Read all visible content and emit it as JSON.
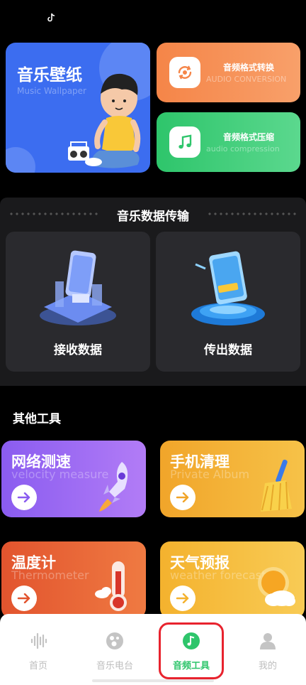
{
  "top_cards": {
    "music_wallpaper": {
      "title": "音乐壁纸",
      "subtitle": "Music Wallpaper"
    },
    "audio_conversion": {
      "title": "音频格式转换",
      "subtitle": "AUDIO CONVERSION"
    },
    "audio_compression": {
      "title": "音频格式压缩",
      "subtitle": "audio compression"
    }
  },
  "transfer": {
    "title": "音乐数据传输",
    "receive_label": "接收数据",
    "send_label": "传出数据"
  },
  "other_tools": {
    "title": "其他工具",
    "items": [
      {
        "title": "网络测速",
        "subtitle": "velocity measure",
        "icon": "rocket-icon"
      },
      {
        "title": "手机清理",
        "subtitle": "Private Album",
        "icon": "broom-icon"
      },
      {
        "title": "温度计",
        "subtitle": "Thermometer",
        "icon": "thermometer-icon"
      },
      {
        "title": "天气预报",
        "subtitle": "weather forecast",
        "icon": "weather-icon"
      }
    ]
  },
  "bottom_nav": {
    "items": [
      {
        "label": "首页",
        "icon": "soundwave-icon"
      },
      {
        "label": "音乐电台",
        "icon": "radio-icon"
      },
      {
        "label": "音频工具",
        "icon": "music-note-icon"
      },
      {
        "label": "我的",
        "icon": "person-icon"
      }
    ],
    "active_index": 2
  },
  "colors": {
    "accent_green": "#2ec56b",
    "highlight_red": "#e8232e",
    "wallpaper_blue": "#3c6df0"
  }
}
